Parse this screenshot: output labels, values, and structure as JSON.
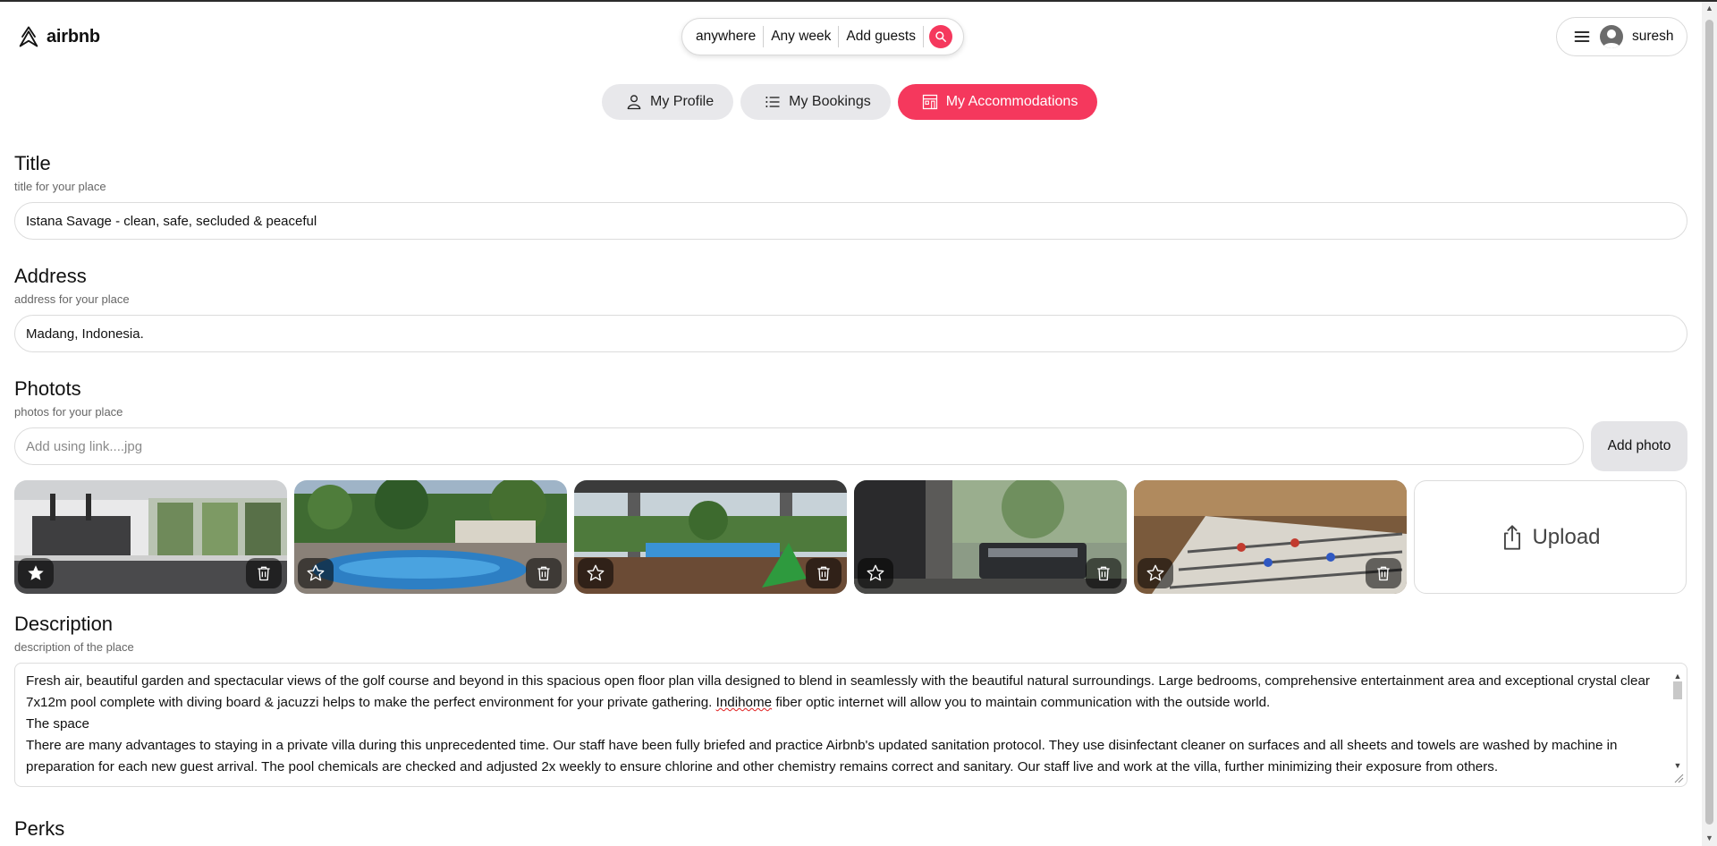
{
  "brand": {
    "name": "airbnb",
    "accent": "#f5385d"
  },
  "search": {
    "where": "anywhere",
    "when": "Any week",
    "who": "Add guests"
  },
  "user": {
    "name": "suresh"
  },
  "tabs": [
    {
      "label": "My Profile",
      "icon": "person-icon",
      "active": false
    },
    {
      "label": "My Bookings",
      "icon": "list-icon",
      "active": false
    },
    {
      "label": "My Accommodations",
      "icon": "building-icon",
      "active": true
    }
  ],
  "form": {
    "title": {
      "heading": "Title",
      "sub": "title for your place",
      "value": "Istana Savage - clean, safe, secluded & peaceful"
    },
    "address": {
      "heading": "Address",
      "sub": "address for your place",
      "value": "Madang, Indonesia."
    },
    "photos": {
      "heading": "Photots",
      "sub": "photos for your place",
      "placeholder": "Add using link....jpg",
      "add_button": "Add photo",
      "upload_label": "Upload",
      "items": [
        {
          "subject": "kitchen interior",
          "main": true
        },
        {
          "subject": "pool and garden",
          "main": false
        },
        {
          "subject": "terrace pool view",
          "main": false
        },
        {
          "subject": "barbecue grill",
          "main": false
        },
        {
          "subject": "foosball table",
          "main": false
        }
      ]
    },
    "description": {
      "heading": "Description",
      "sub": "description of the place",
      "line1_before": "Fresh air, beautiful garden and spectacular views of the golf course and beyond in this spacious open floor plan villa designed to blend in seamlessly with the beautiful natural surroundings. Large bedrooms, comprehensive entertainment area and exceptional crystal clear 7x12m pool complete with diving board & jacuzzi helps to make the perfect environment for your private gathering. ",
      "line1_misspelled": "Indihome",
      "line1_after": " fiber optic internet will allow you to maintain communication with the outside world.",
      "line2": "The space",
      "line3": "There are many advantages to staying in a private villa during this unprecedented time. Our staff have been fully briefed and practice Airbnb's updated sanitation protocol. They use disinfectant cleaner on surfaces and all sheets and towels are washed by machine in preparation for each new guest arrival. The pool chemicals are checked and adjusted 2x weekly to ensure chlorine and other chemistry remains correct and sanitary. Our staff live and work at the villa, further minimizing their exposure from others."
    },
    "perks": {
      "heading": "Perks"
    }
  }
}
